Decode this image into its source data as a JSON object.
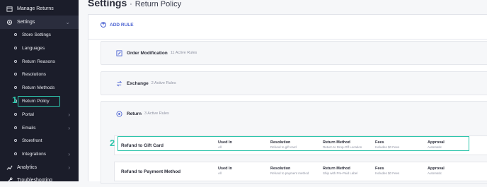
{
  "sidebar": {
    "items": [
      {
        "label": "Manage Returns",
        "icon": "package-icon"
      },
      {
        "label": "Settings",
        "icon": "gear-icon"
      },
      {
        "label": "Store Settings"
      },
      {
        "label": "Languages"
      },
      {
        "label": "Return Reasons"
      },
      {
        "label": "Resolutions"
      },
      {
        "label": "Return Methods"
      },
      {
        "label": "Return Policy"
      },
      {
        "label": "Portal"
      },
      {
        "label": "Emails"
      },
      {
        "label": "Storefront"
      },
      {
        "label": "Integrations"
      },
      {
        "label": "Analytics",
        "icon": "chart-icon"
      },
      {
        "label": "Troubleshooting",
        "icon": "wrench-icon"
      }
    ]
  },
  "annotations": {
    "step1": "1",
    "step2": "2"
  },
  "header": {
    "title": "Settings",
    "separator": "·",
    "subtitle": "Return Policy"
  },
  "toolbar": {
    "add_rule_label": "ADD RULE"
  },
  "sections": [
    {
      "name": "Order Modification",
      "count": "11 Active Rules",
      "icon": "edit-icon"
    },
    {
      "name": "Exchange",
      "count": "2 Active Rules",
      "icon": "exchange-icon"
    },
    {
      "name": "Return",
      "count": "3 Active Rules",
      "icon": "return-icon"
    }
  ],
  "rules": [
    {
      "name": "Refund to Gift Card",
      "used_in_h": "Used In",
      "used_in": "All",
      "resolution_h": "Resolution",
      "resolution": "Refund to gift card",
      "method_h": "Return Method",
      "method": "Return to Drop-Off Location",
      "fees_h": "Fees",
      "fees": "Includes $0 Fees",
      "approval_h": "Approval",
      "approval": "Automatic"
    },
    {
      "name": "Refund to Payment Method",
      "used_in_h": "Used In",
      "used_in": "All",
      "resolution_h": "Resolution",
      "resolution": "Refund to payment method",
      "method_h": "Return Method",
      "method": "Ship with Pre-Paid Label",
      "fees_h": "Fees",
      "fees": "Includes $0 Fees",
      "approval_h": "Approval",
      "approval": "Automatic"
    }
  ],
  "colors": {
    "sidebar": "#1b1d2a",
    "accent": "#4c63d2",
    "highlight": "#2dc5ab"
  }
}
